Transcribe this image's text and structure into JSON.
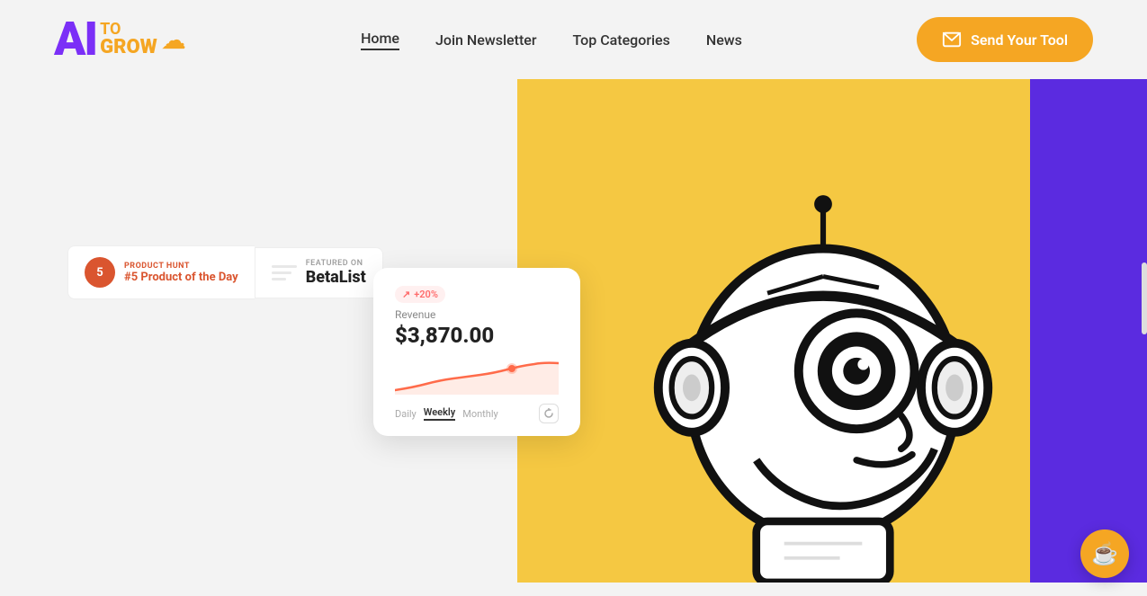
{
  "logo": {
    "ai": "AI",
    "to": "TO",
    "grow": "GROW",
    "cloud": "☁"
  },
  "nav": {
    "items": [
      {
        "label": "Home",
        "active": true
      },
      {
        "label": "Join Newsletter",
        "active": false
      },
      {
        "label": "Top Categories",
        "active": false
      },
      {
        "label": "News",
        "active": false
      }
    ],
    "cta": "Send Your Tool"
  },
  "badges": {
    "producthunt": {
      "label": "PRODUCT HUNT",
      "value": "#5 Product of the Day",
      "number": "5"
    },
    "betalist": {
      "label": "FEATURED ON",
      "value": "BetaList"
    }
  },
  "revenue_card": {
    "badge": "+20%",
    "label": "Revenue",
    "amount": "$3,870.00",
    "tabs": [
      "Daily",
      "Weekly",
      "Monthly"
    ],
    "active_tab": "Weekly"
  },
  "hero_image": {
    "alt": "AI Robot illustration"
  }
}
